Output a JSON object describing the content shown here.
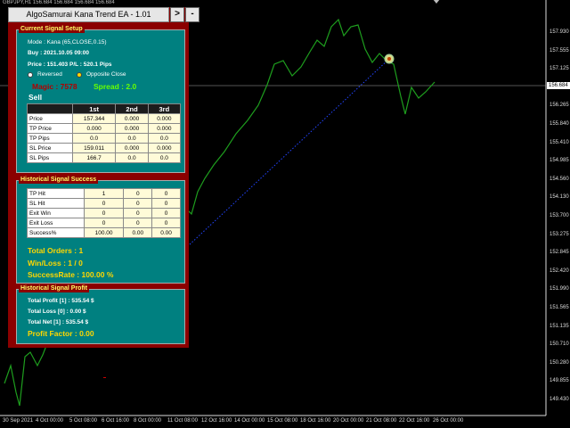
{
  "chart": {
    "symbol": "GBPJPY,H1  156.684 156.684 156.684 156.684",
    "current_price": "156.684",
    "y_ticks": [
      "157.930",
      "157.555",
      "157.125",
      "156.684",
      "156.265",
      "155.840",
      "155.410",
      "154.985",
      "154.560",
      "154.130",
      "153.700",
      "153.275",
      "152.845",
      "152.420",
      "151.990",
      "151.565",
      "151.135",
      "150.710",
      "150.280",
      "149.855",
      "149.430"
    ],
    "x_ticks": [
      "30 Sep 2021",
      "4 Oct 00:00",
      "5 Oct 08:00",
      "6 Oct 16:00",
      "8 Oct 00:00",
      "11 Oct 08:00",
      "12 Oct 16:00",
      "14 Oct 00:00",
      "15 Oct 08:00",
      "18 Oct 16:00",
      "20 Oct 00:00",
      "21 Oct 08:00",
      "22 Oct 16:00",
      "26 Oct 00:00"
    ],
    "series_color": "#1e9e1e"
  },
  "ea": {
    "title": "AlgoSamurai Kana Trend EA - 1.01",
    "btn_minimize": "-",
    "btn_expand": ">",
    "setup": {
      "header": "Current Signal Setup",
      "mode": "Mode : Kana (65,CLOSE,0.15)",
      "buy": "Buy : 2021.10.05 09:00",
      "price_pl": "Price : 151.403   P/L : 520.1 Pips",
      "reversed": "Reversed",
      "opposite_close": "Opposite Close",
      "magic": "Magic : 7578",
      "spread": "Spread : 2.0",
      "sell": "Sell",
      "cols": [
        "1st",
        "2nd",
        "3rd"
      ],
      "rows": [
        {
          "label": "Price",
          "v": [
            "157.344",
            "0.000",
            "0.000"
          ]
        },
        {
          "label": "TP Price",
          "v": [
            "0.000",
            "0.000",
            "0.000"
          ]
        },
        {
          "label": "TP Pips",
          "v": [
            "0.0",
            "0.0",
            "0.0"
          ]
        },
        {
          "label": "SL Price",
          "v": [
            "159.011",
            "0.000",
            "0.000"
          ]
        },
        {
          "label": "SL Pips",
          "v": [
            "166.7",
            "0.0",
            "0.0"
          ]
        }
      ]
    },
    "success": {
      "header": "Historical Signal Success",
      "rows": [
        {
          "label": "TP Hit",
          "v": [
            "1",
            "0",
            "0"
          ]
        },
        {
          "label": "SL Hit",
          "v": [
            "0",
            "0",
            "0"
          ]
        },
        {
          "label": "Exit Win",
          "v": [
            "0",
            "0",
            "0"
          ]
        },
        {
          "label": "Exit Loss",
          "v": [
            "0",
            "0",
            "0"
          ]
        },
        {
          "label": "Success%",
          "v": [
            "100.00",
            "0.00",
            "0.00"
          ]
        }
      ],
      "total_orders": "Total Orders : 1",
      "winloss": "Win/Loss : 1 / 0",
      "success_rate": "SuccessRate : 100.00 %"
    },
    "profit": {
      "header": "Historical Signal Profit",
      "total_profit": "Total Profit [1] : 535.54 $",
      "total_loss": "Total Loss [0] : 0.00 $",
      "total_net": "Total Net [1] : 535.54 $",
      "profit_factor": "Profit Factor : 0.00"
    }
  }
}
